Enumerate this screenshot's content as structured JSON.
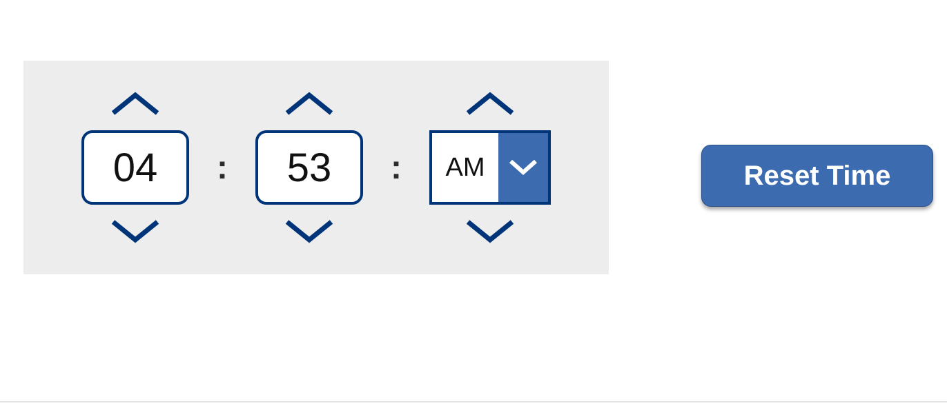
{
  "timePicker": {
    "hour": "04",
    "minute": "53",
    "meridiem": "AM",
    "separator": ":"
  },
  "buttons": {
    "reset": "Reset Time"
  },
  "colors": {
    "darkNavy": "#003478",
    "mediumBlue": "#3c6bb0",
    "panelBg": "#ededed"
  }
}
